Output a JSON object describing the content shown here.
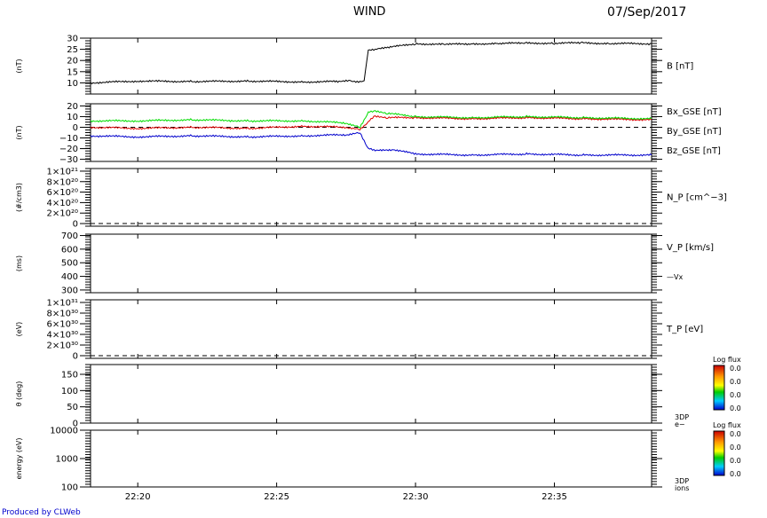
{
  "header": {
    "mission": "WIND",
    "date": "07/Sep/2017"
  },
  "footer": {
    "credit": "Produced by CLWeb"
  },
  "colors": {
    "black": "#000000",
    "red": "#dd0000",
    "green": "#00dd00",
    "blue": "#0000cc",
    "credit": "#0000cc"
  },
  "chart_data": {
    "type": "line",
    "x_axis": {
      "ticks": [
        "22:20",
        "22:25",
        "22:30",
        "22:35"
      ],
      "range_minutes": [
        1338.3,
        1358.5
      ],
      "tick_minutes": [
        1340,
        1345,
        1350,
        1355
      ]
    },
    "panels": [
      {
        "id": "B",
        "ylabel": "(nT)",
        "ylim": [
          5,
          30
        ],
        "ticks": [
          10,
          15,
          20,
          25,
          30
        ],
        "tick_labels": [
          "10",
          "15",
          "20",
          "25",
          "30"
        ],
        "series": [
          {
            "name": "B [nT]",
            "color": "#000000",
            "x": [
              1338.3,
              1340,
              1342,
              1344,
              1346,
              1347.2,
              1347.7,
              1348.0,
              1348.15,
              1348.3,
              1348.6,
              1349.0,
              1350,
              1351,
              1352,
              1353,
              1354,
              1355,
              1356,
              1357,
              1358.5
            ],
            "y": [
              10,
              10.8,
              10.6,
              10.8,
              10.4,
              10.6,
              10.9,
              10.5,
              11,
              24.5,
              25,
              25.8,
              27.5,
              27.2,
              27.4,
              27.6,
              27.8,
              27.7,
              27.9,
              27.6,
              27.5
            ]
          }
        ],
        "legend": [
          {
            "text": "B [nT]",
            "color": "#000000"
          }
        ],
        "dashed_zero": false
      },
      {
        "id": "BGSE",
        "ylabel": "(nT)",
        "ylim": [
          -32,
          22
        ],
        "ticks": [
          20,
          10,
          0,
          -10,
          -20,
          -30
        ],
        "tick_labels": [
          "20",
          "10",
          "0",
          "−10",
          "−20",
          "−30"
        ],
        "series": [
          {
            "name": "Bx_GSE [nT]",
            "color": "#dd0000",
            "x": [
              1338.3,
              1340,
              1342,
              1344,
              1346,
              1347.5,
              1348.0,
              1348.3,
              1348.5,
              1349,
              1350,
              1352,
              1354,
              1356,
              1358.5
            ],
            "y": [
              0,
              -1,
              0,
              -1,
              1,
              0,
              -2,
              5,
              10,
              9,
              9,
              8,
              9,
              8,
              7
            ]
          },
          {
            "name": "By_GSE [nT]",
            "color": "#00dd00",
            "x": [
              1338.3,
              1340,
              1342,
              1344,
              1346,
              1347.5,
              1348.0,
              1348.3,
              1348.5,
              1349,
              1350,
              1352,
              1354,
              1356,
              1358.5
            ],
            "y": [
              6,
              6,
              7,
              6,
              6,
              4,
              0,
              14,
              15,
              13,
              10,
              9,
              10,
              9,
              8
            ]
          },
          {
            "name": "Bz_GSE [nT]",
            "color": "#0000cc",
            "x": [
              1338.3,
              1340,
              1342,
              1344,
              1346,
              1347.5,
              1348.0,
              1348.3,
              1348.6,
              1349.2,
              1350,
              1352,
              1354,
              1356,
              1358.5
            ],
            "y": [
              -8,
              -9,
              -8,
              -9,
              -8,
              -7,
              -5,
              -20,
              -22,
              -21,
              -25,
              -26,
              -25,
              -26,
              -26
            ]
          }
        ],
        "legend": [
          {
            "text": "Bx_GSE [nT]",
            "color": "#dd0000"
          },
          {
            "text": "By_GSE [nT]",
            "color": "#00dd00"
          },
          {
            "text": "Bz_GSE [nT]",
            "color": "#0000cc"
          }
        ],
        "dashed_zero": true
      },
      {
        "id": "NP",
        "ylabel": "(#/cm3)",
        "ylim": [
          -5e+19,
          1.05e+21
        ],
        "ticks": [
          0,
          2e+20,
          4e+20,
          6e+20,
          8e+20,
          1e+21
        ],
        "tick_labels": [
          "0",
          "2×10²⁰",
          "4×10²⁰",
          "6×10²⁰",
          "8×10²⁰",
          "1×10²¹"
        ],
        "series": [],
        "legend": [
          {
            "text": "N_P [cm^−3]",
            "color": "#000000"
          }
        ],
        "dashed_zero": true
      },
      {
        "id": "VP",
        "ylabel": "(ms)",
        "ylim": [
          280,
          710
        ],
        "ticks": [
          300,
          400,
          500,
          600,
          700
        ],
        "tick_labels": [
          "300",
          "400",
          "500",
          "600",
          "700"
        ],
        "series": [],
        "legend": [
          {
            "text": "V_P [km/s]",
            "color": "#000000"
          },
          {
            "text": "—Vx",
            "color": "#dd0000"
          }
        ],
        "dashed_zero": false
      },
      {
        "id": "TP",
        "ylabel": "(eV)",
        "ylim": [
          -5e+29,
          1.05e+31
        ],
        "ticks": [
          0,
          2e+30,
          4e+30,
          6e+30,
          8e+30,
          1e+31
        ],
        "tick_labels": [
          "0",
          "2×10³⁰",
          "4×10³⁰",
          "6×10³⁰",
          "8×10³⁰",
          "1×10³¹"
        ],
        "series": [],
        "legend": [
          {
            "text": "T_P [eV]",
            "color": "#000000"
          }
        ],
        "dashed_zero": true
      },
      {
        "id": "THETA",
        "ylabel": "θ (deg)",
        "ylim": [
          0,
          180
        ],
        "ticks": [
          0,
          50,
          100,
          150
        ],
        "tick_labels": [
          "0",
          "50",
          "100",
          "150"
        ],
        "series": [],
        "legend": [
          {
            "text": "3DP",
            "color": "#000000"
          },
          {
            "text": "e−",
            "color": "#000000"
          }
        ],
        "colorbar": {
          "title": "Log flux",
          "labels": [
            "0.0",
            "0.0",
            "0.0",
            "0.0"
          ]
        },
        "dashed_zero": false
      },
      {
        "id": "ENERGY",
        "ylabel": "energy (eV)",
        "ylim": [
          100,
          10000
        ],
        "log": true,
        "ticks": [
          100,
          1000,
          10000
        ],
        "tick_labels": [
          "100",
          "1000",
          "10000"
        ],
        "series": [],
        "legend": [
          {
            "text": "3DP",
            "color": "#000000"
          },
          {
            "text": "ions",
            "color": "#000000"
          }
        ],
        "colorbar": {
          "title": "Log flux",
          "labels": [
            "0.0",
            "0.0",
            "0.0",
            "0.0"
          ]
        },
        "dashed_zero": false
      }
    ]
  }
}
